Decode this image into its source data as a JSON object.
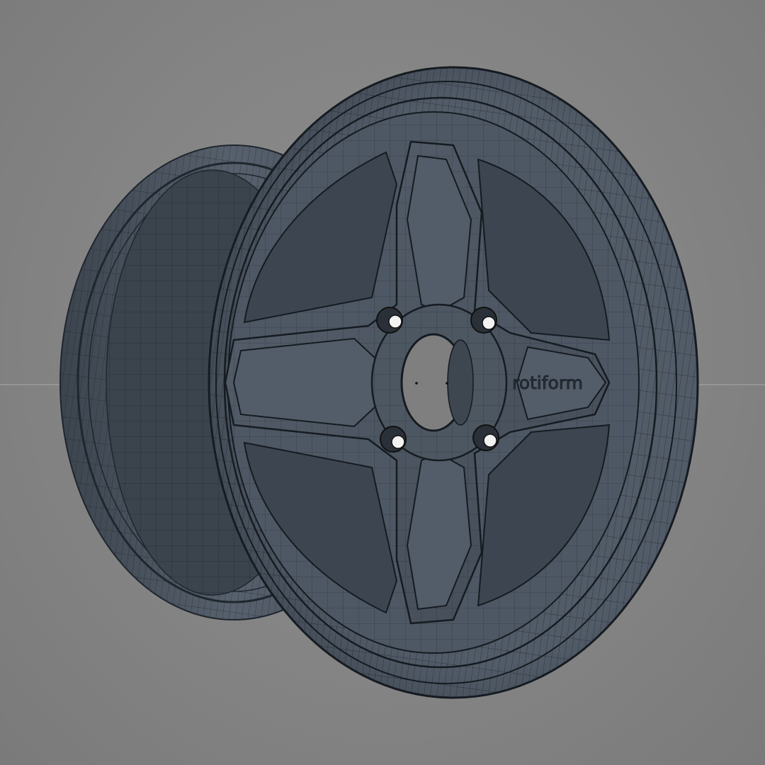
{
  "viewport": {
    "background": "#848484",
    "horizon_line_color": "#aaaaaa"
  },
  "wheel": {
    "logo_text": "rotiform",
    "spoke_count": 4,
    "lug_nut_count": 4,
    "shaded_color": "#4a5460",
    "wire_color": "#1e252d",
    "display_mode": "wireframe-on-shaded"
  }
}
